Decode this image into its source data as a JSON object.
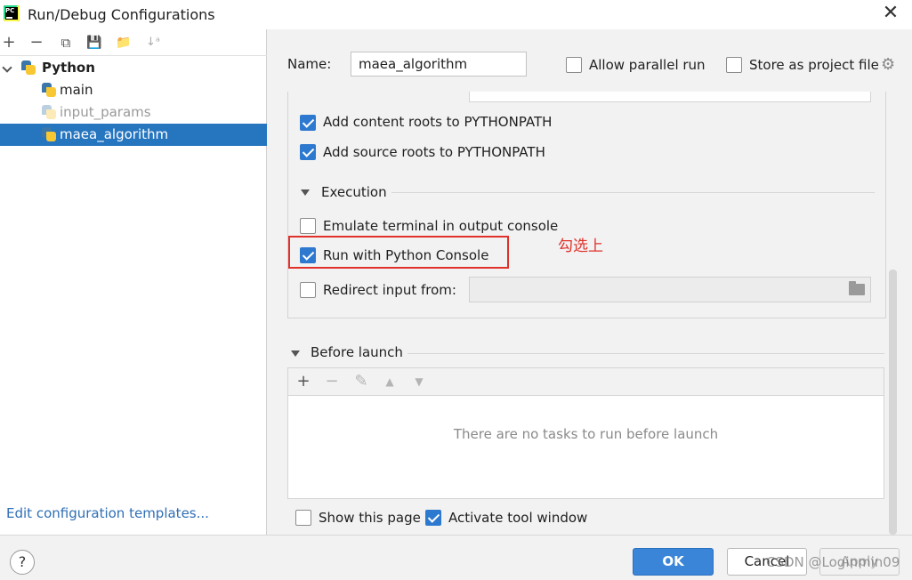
{
  "window": {
    "title": "Run/Debug Configurations",
    "close_glyph": "✕"
  },
  "left_toolbar": {
    "add": "+",
    "remove": "−",
    "copy": "⧉",
    "save": "💾",
    "folder": "📁",
    "sort": "↓ᵃ"
  },
  "tree": {
    "group_label": "Python",
    "items": [
      {
        "label": "main",
        "selected": false,
        "faded": false
      },
      {
        "label": "input_params",
        "selected": false,
        "faded": true
      },
      {
        "label": "maea_algorithm",
        "selected": true,
        "faded": false
      }
    ]
  },
  "edit_templates_link": "Edit configuration templates...",
  "config": {
    "name_label": "Name:",
    "name_value": "maea_algorithm",
    "allow_parallel_label": "Allow parallel run",
    "allow_parallel_checked": false,
    "store_project_label": "Store as project file",
    "store_project_checked": false,
    "add_content_roots_label": "Add content roots to PYTHONPATH",
    "add_content_roots_checked": true,
    "add_source_roots_label": "Add source roots to PYTHONPATH",
    "add_source_roots_checked": true
  },
  "execution": {
    "section_label": "Execution",
    "emulate_terminal_label": "Emulate terminal in output console",
    "emulate_terminal_checked": false,
    "run_python_console_label": "Run with Python Console",
    "run_python_console_checked": true,
    "redirect_input_label": "Redirect input from:",
    "redirect_input_checked": false,
    "redirect_input_value": ""
  },
  "annotation": {
    "text": "勾选上",
    "color": "#e0312b"
  },
  "before_launch": {
    "section_label": "Before launch",
    "tools": {
      "add": "+",
      "remove": "−",
      "edit": "✎",
      "up": "▲",
      "down": "▼"
    },
    "empty_text": "There are no tasks to run before launch",
    "show_page_label": "Show this page",
    "show_page_checked": false,
    "activate_tool_label": "Activate tool window",
    "activate_tool_checked": true
  },
  "buttons": {
    "help": "?",
    "ok": "OK",
    "cancel": "Cancel",
    "apply": "Apply"
  },
  "watermark": "CSDN @Loginmin09",
  "colors": {
    "selection": "#2675bf",
    "primary_button": "#3a85d8",
    "checkbox_on": "#2e79d0",
    "link": "#2f6fb5"
  }
}
